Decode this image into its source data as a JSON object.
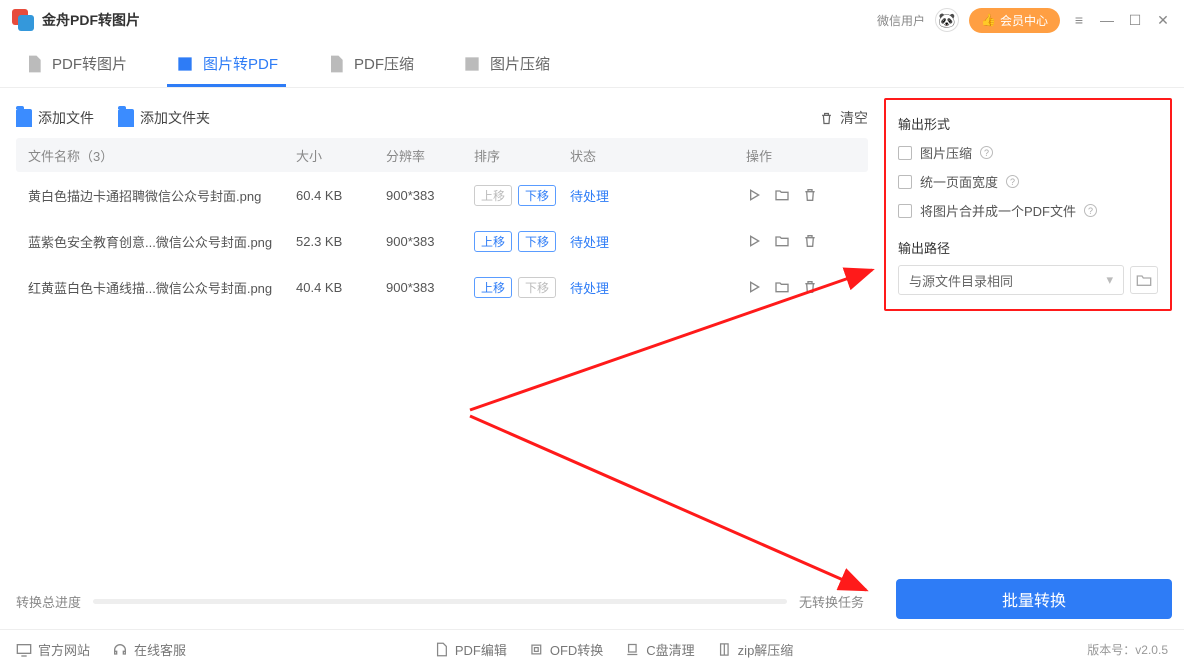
{
  "app": {
    "title": "金舟PDF转图片"
  },
  "titlebar": {
    "user": "微信用户",
    "vip": "会员中心"
  },
  "tabs": [
    {
      "label": "PDF转图片"
    },
    {
      "label": "图片转PDF"
    },
    {
      "label": "PDF压缩"
    },
    {
      "label": "图片压缩"
    }
  ],
  "toolbar": {
    "add_file": "添加文件",
    "add_folder": "添加文件夹",
    "clear": "清空"
  },
  "columns": {
    "name": "文件名称（3）",
    "size": "大小",
    "res": "分辨率",
    "sort": "排序",
    "state": "状态",
    "op": "操作"
  },
  "sortbtn": {
    "up": "上移",
    "down": "下移"
  },
  "state_pending": "待处理",
  "rows": [
    {
      "name": "黄白色描边卡通招聘微信公众号封面.png",
      "size": "60.4 KB",
      "res": "900*383",
      "up_disabled": true,
      "down_disabled": false
    },
    {
      "name": "蓝紫色安全教育创意...微信公众号封面.png",
      "size": "52.3 KB",
      "res": "900*383",
      "up_disabled": false,
      "down_disabled": false
    },
    {
      "name": "红黄蓝白色卡通线描...微信公众号封面.png",
      "size": "40.4 KB",
      "res": "900*383",
      "up_disabled": false,
      "down_disabled": true
    }
  ],
  "output": {
    "section_format": "输出形式",
    "opt_compress": "图片压缩",
    "opt_width": "统一页面宽度",
    "opt_merge": "将图片合并成一个PDF文件",
    "section_path": "输出路径",
    "path_value": "与源文件目录相同"
  },
  "convert": "批量转换",
  "progress": {
    "label": "转换总进度",
    "state": "无转换任务"
  },
  "footer": {
    "site": "官方网站",
    "support": "在线客服",
    "links": [
      "PDF编辑",
      "OFD转换",
      "C盘清理",
      "zip解压缩"
    ],
    "version": "版本号：v2.0.5"
  }
}
